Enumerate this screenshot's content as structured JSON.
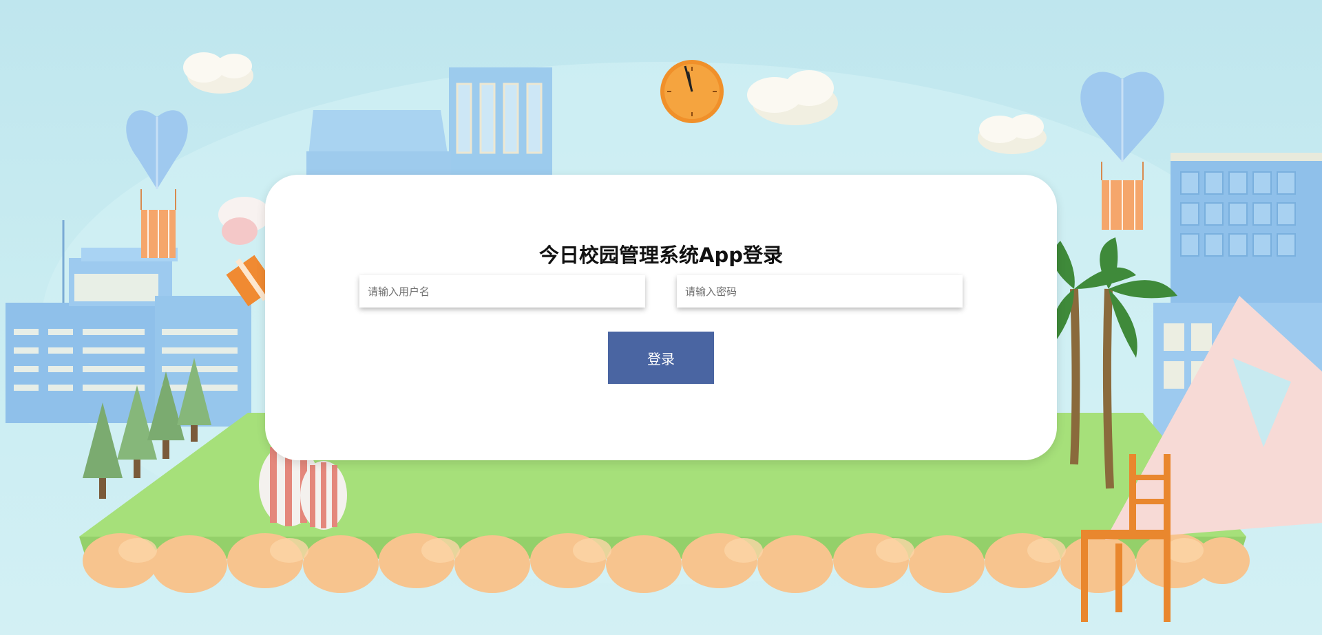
{
  "login": {
    "title": "今日校园管理系统App登录",
    "username_placeholder": "请输入用户名",
    "password_placeholder": "请输入密码",
    "submit_label": "登录"
  },
  "colors": {
    "button": "#4a65a2",
    "card": "#ffffff",
    "sky": "#c4e8ef",
    "grass": "#a8e07c",
    "rocks": "#f6c48e"
  },
  "decor": {
    "clock": "orange wall clock",
    "balloons": "heart-shaped hot-air balloons",
    "buildings": "blue school buildings",
    "trees": "pine trees and palm trees",
    "ruler": "pink triangle ruler",
    "chair": "orange chair"
  }
}
